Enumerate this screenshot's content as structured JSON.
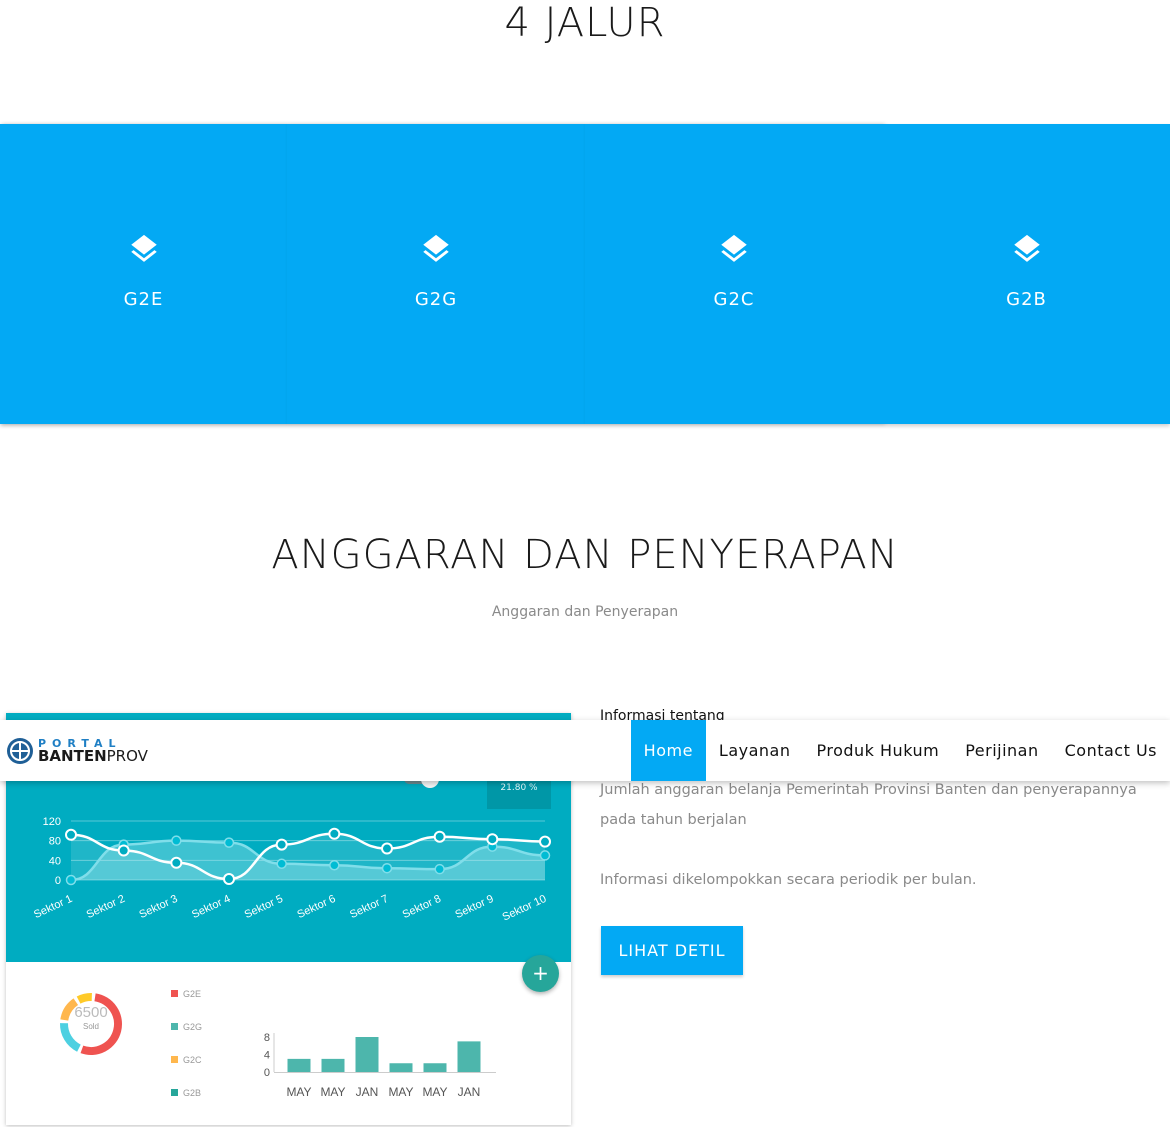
{
  "section1": {
    "title": "4 JALUR"
  },
  "jalur": [
    {
      "label": "G2E",
      "icon": "layers-icon"
    },
    {
      "label": "G2G",
      "icon": "layers-icon"
    },
    {
      "label": "G2C",
      "icon": "layers-icon"
    },
    {
      "label": "G2B",
      "icon": "layers-icon"
    }
  ],
  "section2": {
    "title": "ANGGARAN DAN PENYERAPAN",
    "subtitle": "Anggaran dan Penyerapan"
  },
  "dashboard": {
    "badge": "21.80 %",
    "donut_value": "6500",
    "donut_label": "Sold",
    "legend": [
      "G2E",
      "G2G",
      "G2C",
      "G2B"
    ],
    "fab": "+"
  },
  "chart_data": [
    {
      "type": "line",
      "categories": [
        "Sektor 1",
        "Sektor 2",
        "Sektor 3",
        "Sektor 4",
        "Sektor 5",
        "Sektor 6",
        "Sektor 7",
        "Sektor 8",
        "Sektor 9",
        "Sektor 10"
      ],
      "ylim": [
        0,
        120
      ],
      "yticks": [
        0,
        40,
        80,
        120
      ],
      "series": [
        {
          "values": [
            92,
            60,
            35,
            2,
            72,
            94,
            64,
            88,
            83,
            78
          ]
        },
        {
          "values": [
            0,
            72,
            80,
            76,
            33,
            30,
            24,
            22,
            68,
            50
          ]
        }
      ]
    },
    {
      "type": "bar",
      "categories": [
        "MAY",
        "MAY",
        "JAN",
        "MAY",
        "MAY",
        "JAN"
      ],
      "values": [
        3,
        3,
        8,
        2,
        2,
        7
      ],
      "ylim": [
        0,
        8
      ],
      "yticks": [
        0,
        4,
        8
      ]
    },
    {
      "type": "pie",
      "values": [
        55,
        20,
        15,
        10
      ],
      "colors": [
        "#ef5350",
        "#4dd0e1",
        "#ffb74d",
        "#ffca28"
      ]
    }
  ],
  "info": {
    "title": "Informasi tentang",
    "p1": "Jumlah anggaran belanja Pemerintah Provinsi Banten dan penyerapannya pada tahun berjalan",
    "p2": "Informasi dikelompokkan secara periodik per bulan.",
    "button": "LIHAT DETIL"
  },
  "navbar": {
    "logo_top": "PORTAL",
    "logo_bold": "BANTEN",
    "logo_light": "PROV",
    "items": [
      "Home",
      "Layanan",
      "Produk Hukum",
      "Perijinan",
      "Contact Us"
    ],
    "active": "Home"
  },
  "colors": {
    "accent": "#03a9f4",
    "teal": "#00acc1",
    "fab": "#26a69a"
  }
}
